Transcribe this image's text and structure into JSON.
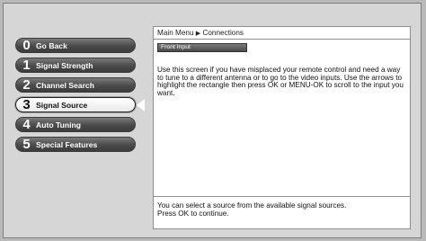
{
  "breadcrumb": {
    "root": "Main Menu",
    "current": "Connections",
    "separator_icon": "right-triangle-icon"
  },
  "menu": {
    "items": [
      {
        "number": "0",
        "label": "Go Back"
      },
      {
        "number": "1",
        "label": "Signal Strength"
      },
      {
        "number": "2",
        "label": "Channel Search"
      },
      {
        "number": "3",
        "label": "Signal Source"
      },
      {
        "number": "4",
        "label": "Auto Tuning"
      },
      {
        "number": "5",
        "label": "Special Features"
      }
    ],
    "selected_index": 3
  },
  "panel": {
    "input_selector": "Front Input",
    "description": "Use this screen if you have misplaced your remote control and need a way to tune to a different antenna or to go to the video inputs. Use the arrows to highlight the rectangle then press OK or MENU-OK to scroll to the input you want."
  },
  "footer": {
    "line1": "You can select a source from the available signal sources.",
    "line2": "Press OK to continue."
  },
  "colors": {
    "button_dark": "#4a4a4a",
    "button_selected": "#ffffff",
    "background": "#d6d6d6",
    "panel": "#ffffff"
  }
}
